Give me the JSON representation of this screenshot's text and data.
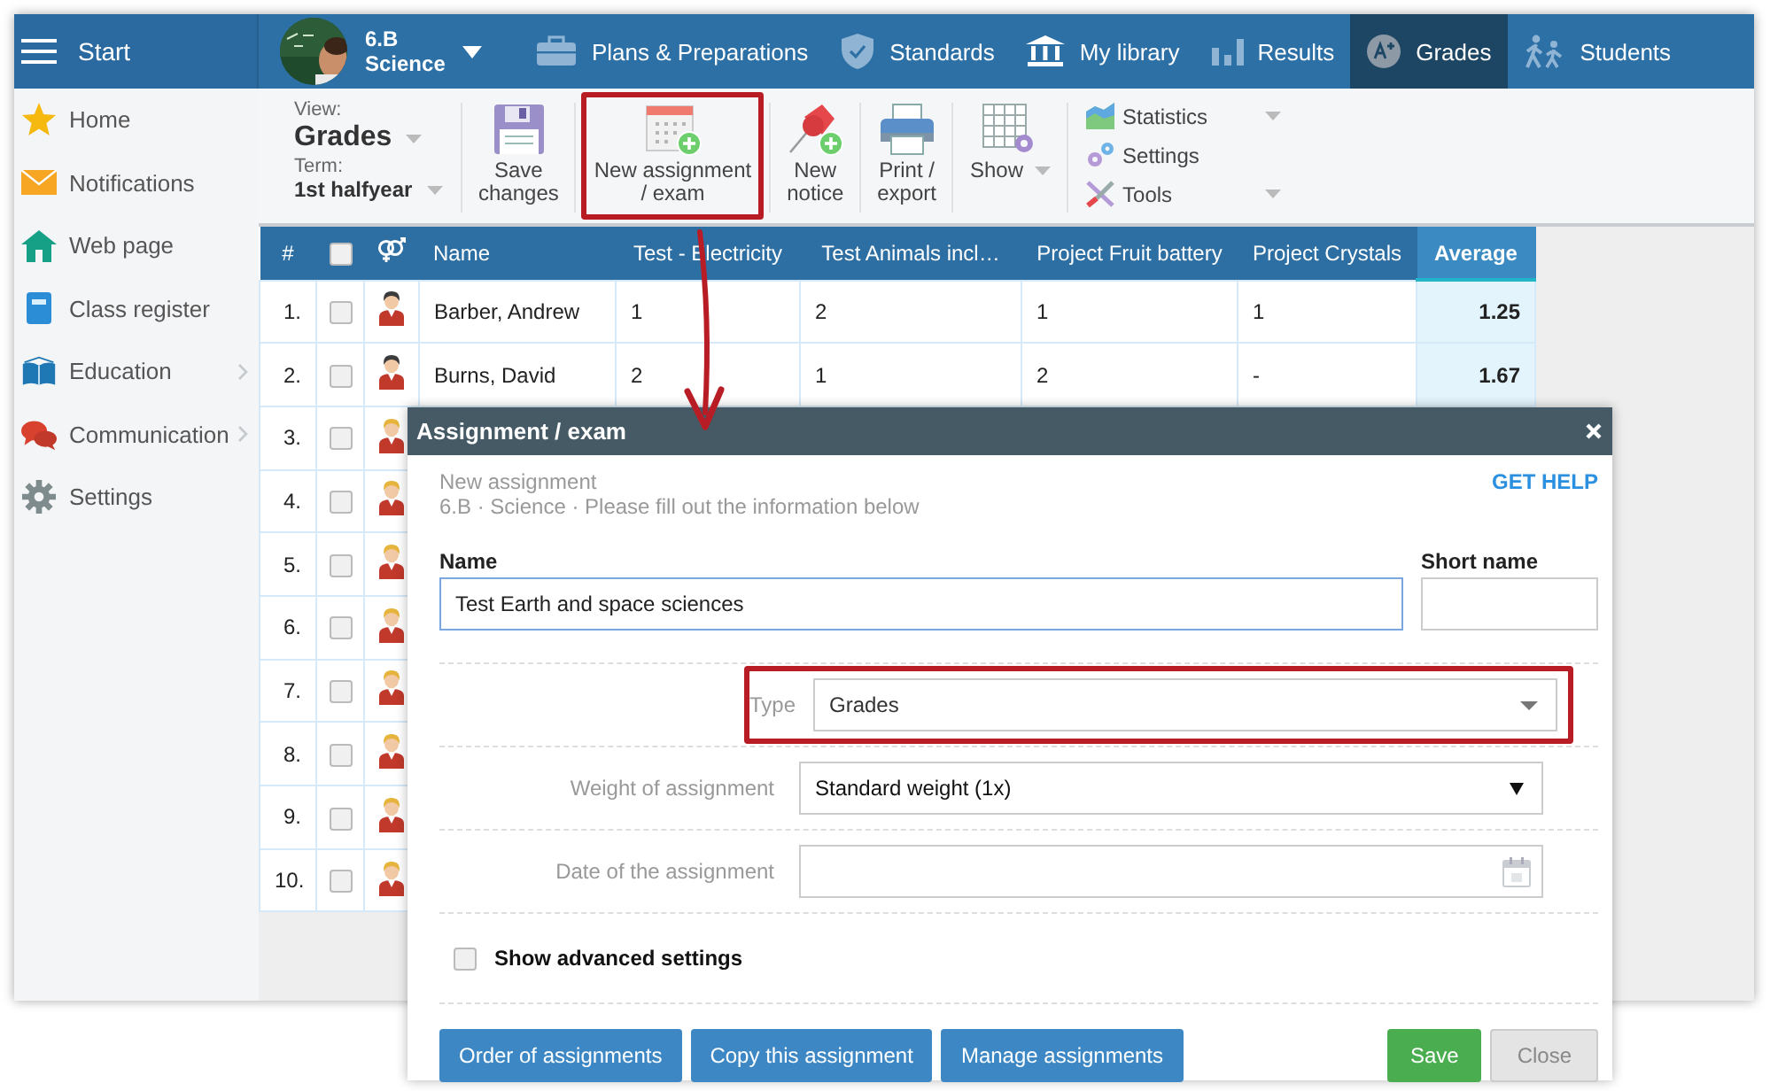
{
  "top_bar": {
    "start_label": "Start",
    "class": {
      "name": "6.B",
      "subject": "Science"
    },
    "nav": [
      {
        "label": "Plans & Preparations",
        "selected": false
      },
      {
        "label": "Standards",
        "selected": false
      },
      {
        "label": "My library",
        "selected": false
      },
      {
        "label": "Results",
        "selected": false
      },
      {
        "label": "Grades",
        "selected": true
      },
      {
        "label": "Students",
        "selected": false
      }
    ]
  },
  "sidebar": {
    "items": [
      {
        "label": "Home",
        "has_submenu": false
      },
      {
        "label": "Notifications",
        "has_submenu": false
      },
      {
        "label": "Web page",
        "has_submenu": false
      },
      {
        "label": "Class register",
        "has_submenu": false
      },
      {
        "label": "Education",
        "has_submenu": true
      },
      {
        "label": "Communication",
        "has_submenu": true
      },
      {
        "label": "Settings",
        "has_submenu": false
      }
    ]
  },
  "toolbar": {
    "view": {
      "label": "View:",
      "value": "Grades"
    },
    "term": {
      "label": "Term:",
      "value": "1st halfyear"
    },
    "buttons": [
      {
        "lines": [
          "Save",
          "changes"
        ],
        "highlighted": false,
        "dropdown": false
      },
      {
        "lines": [
          "New assignment",
          "/ exam"
        ],
        "highlighted": true,
        "dropdown": false
      },
      {
        "lines": [
          "New",
          "notice"
        ],
        "highlighted": false,
        "dropdown": false
      },
      {
        "lines": [
          "Print /",
          "export"
        ],
        "highlighted": false,
        "dropdown": false
      },
      {
        "lines": [
          "Show"
        ],
        "highlighted": false,
        "dropdown": true
      }
    ],
    "menu": [
      {
        "label": "Statistics",
        "dropdown": true
      },
      {
        "label": "Settings",
        "dropdown": false
      },
      {
        "label": "Tools",
        "dropdown": true
      }
    ]
  },
  "table": {
    "header": {
      "number": "#",
      "checked": false
    },
    "columns": [
      {
        "label": "Name",
        "kind": "text"
      },
      {
        "label": "Test - Electricity",
        "kind": "grade"
      },
      {
        "label": "Test Animals incl…",
        "kind": "grade"
      },
      {
        "label": "Project Fruit battery",
        "kind": "grade"
      },
      {
        "label": "Project Crystals",
        "kind": "grade"
      },
      {
        "label": "Average",
        "kind": "average"
      }
    ],
    "rows": [
      {
        "number": "1.",
        "checked": false,
        "color": "#3b3b3b",
        "cells": [
          "Barber, Andrew",
          "1",
          "2",
          "1",
          "1",
          "1.25"
        ]
      },
      {
        "number": "2.",
        "checked": false,
        "color": "#3b3b3b",
        "cells": [
          "Burns, David",
          "2",
          "1",
          "2",
          "-",
          "1.67"
        ]
      },
      {
        "number": "3.",
        "checked": false,
        "color": "#e6b43c"
      },
      {
        "number": "4.",
        "checked": false,
        "color": "#e6b43c"
      },
      {
        "number": "5.",
        "checked": false,
        "color": "#e6b43c"
      },
      {
        "number": "6.",
        "checked": false,
        "color": "#e6b43c"
      },
      {
        "number": "7.",
        "checked": false,
        "color": "#e6b43c"
      },
      {
        "number": "8.",
        "checked": false,
        "color": "#e6b43c"
      },
      {
        "number": "9.",
        "checked": false,
        "color": "#e6b43c"
      },
      {
        "number": "10.",
        "checked": false,
        "color": "#e6b43c"
      }
    ]
  },
  "callout_arrow": true,
  "dialog": {
    "title": "Assignment / exam",
    "heading": "New assignment",
    "context": "6.B · Science · Please fill out the information below",
    "help_link": "GET HELP",
    "name_field": {
      "label": "Name",
      "value": "Test Earth and space sciences"
    },
    "short_name_field": {
      "label": "Short name"
    },
    "rows": [
      {
        "label": "Type",
        "kind": "select",
        "value": "Grades",
        "highlighted": true
      },
      {
        "label": "Weight of assignment",
        "kind": "native-select",
        "value": "Standard weight (1x)",
        "highlighted": false
      },
      {
        "label": "Date of the assignment",
        "kind": "date",
        "highlighted": false
      }
    ],
    "advanced": {
      "label": "Show advanced settings",
      "checked": false
    },
    "buttons": [
      {
        "label": "Order of assignments",
        "kind": "info"
      },
      {
        "label": "Copy this assignment",
        "kind": "info"
      },
      {
        "label": "Manage assignments",
        "kind": "info"
      },
      {
        "label": "Save",
        "kind": "success"
      },
      {
        "label": "Close",
        "kind": "default"
      }
    ]
  }
}
